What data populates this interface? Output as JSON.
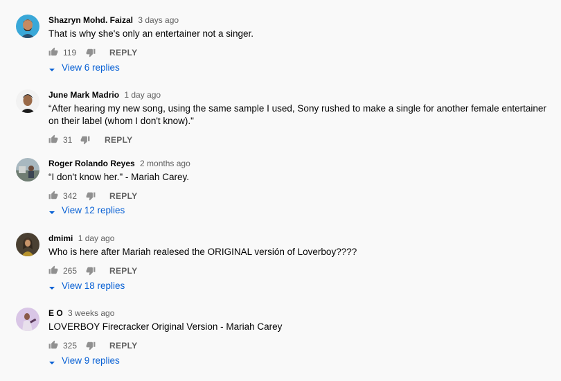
{
  "comments": [
    {
      "author": "Shazryn Mohd. Faizal",
      "time": "3 days ago",
      "text": "That is why she's only an entertainer not a singer.",
      "likes": "119",
      "reply_label": "REPLY",
      "view_replies": "View 6 replies",
      "avatar_color": "#3aa8d8"
    },
    {
      "author": "June Mark Madrio",
      "time": "1 day ago",
      "text": "“After hearing my new song, using the same sample I used, Sony rushed to make a single for another female entertainer on their label (whom I don't know).\"",
      "likes": "31",
      "reply_label": "REPLY",
      "view_replies": "",
      "avatar_color": "#f2f2f2"
    },
    {
      "author": "Roger Rolando Reyes",
      "time": "2 months ago",
      "text": "“I don't know her.\" - Mariah Carey.",
      "likes": "342",
      "reply_label": "REPLY",
      "view_replies": "View 12 replies",
      "avatar_color": "#8fa0a8"
    },
    {
      "author": "dmimi",
      "time": "1 day ago",
      "text": "Who is here after Mariah realesed the ORIGINAL versión of Loverboy????",
      "likes": "265",
      "reply_label": "REPLY",
      "view_replies": "View 18 replies",
      "avatar_color": "#4a4032"
    },
    {
      "author": "E O",
      "time": "3 weeks ago",
      "text": "LOVERBOY Firecracker Original Version - Mariah Carey",
      "likes": "325",
      "reply_label": "REPLY",
      "view_replies": "View 9 replies",
      "avatar_color": "#d9c6e6"
    }
  ],
  "colors": {
    "link": "#065fd4",
    "secondary_text": "#606060",
    "background": "#f9f9f9"
  }
}
